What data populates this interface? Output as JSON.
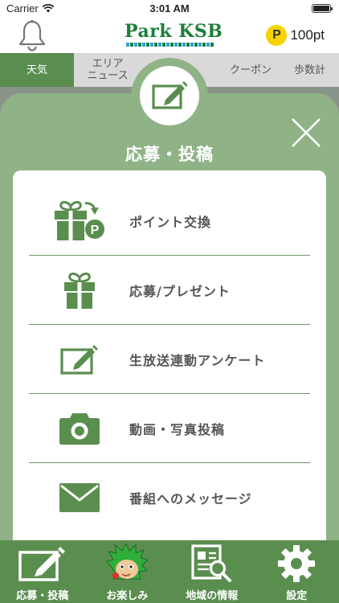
{
  "status_bar": {
    "carrier": "Carrier",
    "time": "3:01 AM"
  },
  "header": {
    "logo_text": "Park KSB",
    "points": {
      "coin_letter": "P",
      "amount": "100pt"
    }
  },
  "tabs": [
    {
      "label": "天気",
      "active": true
    },
    {
      "label": "エリア\nニュース",
      "active": false
    },
    {
      "label": "",
      "active": false
    },
    {
      "label": "クーポン",
      "active": false
    },
    {
      "label": "歩数計",
      "active": false
    }
  ],
  "modal": {
    "title": "応募・投稿",
    "items": [
      {
        "label": "ポイント交換",
        "icon": "gift-points-icon"
      },
      {
        "label": "応募/プレゼント",
        "icon": "gift-icon"
      },
      {
        "label": "生放送連動アンケート",
        "icon": "edit-icon"
      },
      {
        "label": "動画・写真投稿",
        "icon": "camera-icon"
      },
      {
        "label": "番組へのメッセージ",
        "icon": "mail-icon"
      }
    ]
  },
  "bottom_nav": [
    {
      "label": "応募・投稿",
      "icon": "edit-icon"
    },
    {
      "label": "お楽しみ",
      "icon": "mascot-icon"
    },
    {
      "label": "地域の情報",
      "icon": "newspaper-search-icon"
    },
    {
      "label": "設定",
      "icon": "gear-icon"
    }
  ],
  "colors": {
    "accent_green": "#5a8e4f",
    "modal_green": "#8fb387",
    "coin_yellow": "#f5d400"
  }
}
